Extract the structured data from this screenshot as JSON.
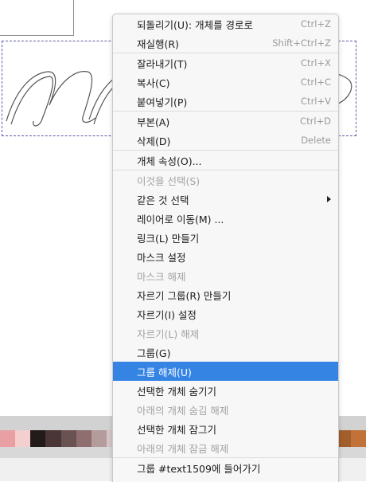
{
  "canvas": {
    "text_object_label": "mm",
    "palette": [
      "#e8a0a4",
      "#f3cfd0",
      "#231a1a",
      "#4a3636",
      "#6b5252",
      "#8e6e6e",
      "#b49c9c",
      "#d5c6c6",
      "#ecd7d7",
      "#7d3d3d",
      "#9c5a5a",
      "#b37777",
      "#c98f8f",
      "#e0a8a8",
      "#f2c3c3",
      "#3b2a2a",
      "#5e4343",
      "#805d5d",
      "#a17878",
      "#c29393",
      "#e3aeae",
      "#8b4a1f",
      "#a35f2b",
      "#c07238"
    ]
  },
  "menu": {
    "items": [
      {
        "label": "되돌리기(U): 개체를 경로로",
        "shortcut": "Ctrl+Z",
        "disabled": false
      },
      {
        "label": "재실행(R)",
        "shortcut": "Shift+Ctrl+Z",
        "disabled": false
      },
      {
        "label": "잘라내기(T)",
        "shortcut": "Ctrl+X",
        "disabled": false
      },
      {
        "label": "복사(C)",
        "shortcut": "Ctrl+C",
        "disabled": false
      },
      {
        "label": "붙여넣기(P)",
        "shortcut": "Ctrl+V",
        "disabled": false
      },
      {
        "label": "부본(A)",
        "shortcut": "Ctrl+D",
        "disabled": false
      },
      {
        "label": "삭제(D)",
        "shortcut": "Delete",
        "disabled": false
      },
      {
        "label": "개체 속성(O)...",
        "shortcut": "",
        "disabled": false
      },
      {
        "label": "이것을 선택(S)",
        "shortcut": "",
        "disabled": true
      },
      {
        "label": "같은 것 선택",
        "shortcut": "",
        "disabled": false
      },
      {
        "label": "레이어로 이동(M) ...",
        "shortcut": "",
        "disabled": false
      },
      {
        "label": "링크(L) 만들기",
        "shortcut": "",
        "disabled": false
      },
      {
        "label": "마스크 설정",
        "shortcut": "",
        "disabled": false
      },
      {
        "label": "마스크 해제",
        "shortcut": "",
        "disabled": true
      },
      {
        "label": "자르기 그룹(R) 만들기",
        "shortcut": "",
        "disabled": false
      },
      {
        "label": "자르기(I) 설정",
        "shortcut": "",
        "disabled": false
      },
      {
        "label": "자르기(L) 해제",
        "shortcut": "",
        "disabled": true
      },
      {
        "label": "그룹(G)",
        "shortcut": "",
        "disabled": false
      },
      {
        "label": "그룹 해제(U)",
        "shortcut": "",
        "disabled": false
      },
      {
        "label": "선택한 개체 숨기기",
        "shortcut": "",
        "disabled": false
      },
      {
        "label": "아래의 개체 숨김 해제",
        "shortcut": "",
        "disabled": true
      },
      {
        "label": "선택한 개체 잠그기",
        "shortcut": "",
        "disabled": false
      },
      {
        "label": "아래의 개체 잠금 해제",
        "shortcut": "",
        "disabled": true
      },
      {
        "label": "그룹 #text1509에 들어가기",
        "shortcut": "",
        "disabled": false
      }
    ]
  }
}
